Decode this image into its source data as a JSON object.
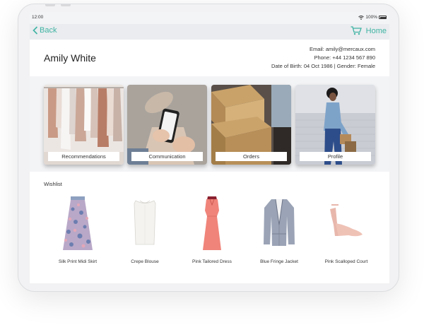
{
  "status_bar": {
    "time": "12:00",
    "battery": "100%"
  },
  "nav": {
    "back_label": "Back",
    "home_label": "Home"
  },
  "customer": {
    "name": "Amily White",
    "email_line": "Email: amily@mercaux.com",
    "phone_line": "Phone: +44 1234 567 890",
    "dob_gender_line": "Date of Birth: 04 Oct 1986 | Gender: Female"
  },
  "tiles": [
    {
      "label": "Recommendations",
      "icon": "clothes-rack-photo"
    },
    {
      "label": "Communication",
      "icon": "phone-in-hand-photo"
    },
    {
      "label": "Orders",
      "icon": "boxes-photo"
    },
    {
      "label": "Profile",
      "icon": "woman-with-bags-photo"
    }
  ],
  "wishlist": {
    "title": "Wishlist",
    "items": [
      {
        "name": "Silk Print Midi Skirt",
        "icon": "skirt-image"
      },
      {
        "name": "Crepe Blouse",
        "icon": "blouse-image"
      },
      {
        "name": "Pink Tailored Dress",
        "icon": "dress-image"
      },
      {
        "name": "Blue Fringe Jacket",
        "icon": "jacket-image"
      },
      {
        "name": "Pink Scalloped Court",
        "icon": "shoe-image"
      }
    ]
  },
  "colors": {
    "accent": "#3fb3a3",
    "screen_bg": "#f3f4f6",
    "nav_bg": "#eaecef"
  }
}
